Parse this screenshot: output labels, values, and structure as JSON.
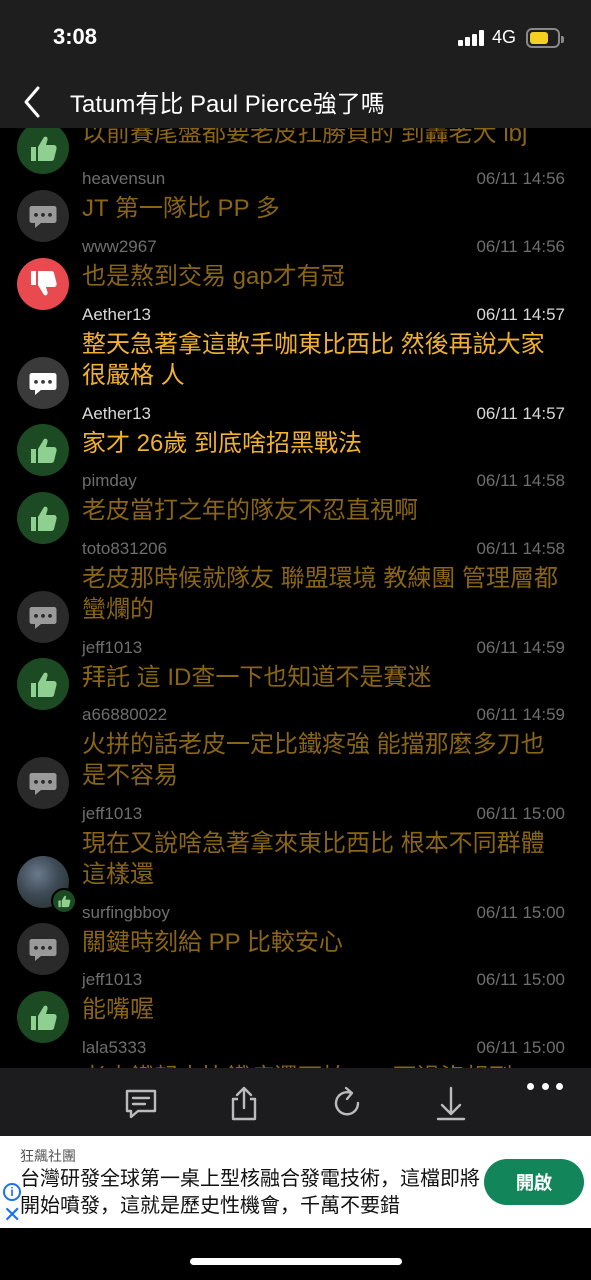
{
  "status_bar": {
    "time": "3:08",
    "network": "4G",
    "battery_level": 0.7
  },
  "header": {
    "title": "Tatum有比 Paul Pierce強了嗎"
  },
  "comments": [
    {
      "user": "",
      "date": "",
      "text": "以前賽尾盤都要老皮扛勝負的 到轟老大 lbj",
      "avatar": "msg"
    },
    {
      "user": "heavensun",
      "date": "06/11 14:56",
      "text": "JT 第一隊比 PP  多",
      "avatar": "up"
    },
    {
      "user": "www2967",
      "date": "06/11 14:56",
      "text": "也是熬到交易 gap才有冠",
      "avatar": "msg"
    },
    {
      "user": "Aether13",
      "date": "06/11 14:57",
      "text": "整天急著拿這軟手咖東比西比 然後再說大家很嚴格 人",
      "avatar": "down",
      "highlight": true
    },
    {
      "user": "Aether13",
      "date": "06/11 14:57",
      "text": "家才 26歲 到底啥招黑戰法",
      "avatar": "msg",
      "highlight": true
    },
    {
      "user": "pimday",
      "date": "06/11 14:58",
      "text": "老皮當打之年的隊友不忍直視啊",
      "avatar": "up"
    },
    {
      "user": "toto831206",
      "date": "06/11 14:58",
      "text": "老皮那時候就隊友 聯盟環境 教練團 管理層都蠻爛的",
      "avatar": "up"
    },
    {
      "user": "jeff1013",
      "date": "06/11 14:59",
      "text": "拜託 這 ID查一下也知道不是賽迷",
      "avatar": "msg"
    },
    {
      "user": "a66880022",
      "date": "06/11 14:59",
      "text": "火拼的話老皮一定比鐵疼強 能擋那麼多刀也是不容易",
      "avatar": "up"
    },
    {
      "user": "jeff1013",
      "date": "06/11 15:00",
      "text": "現在又說啥急著拿來東比西比 根本不同群體 這樣還",
      "avatar": "msg"
    },
    {
      "user": "surfingbboy",
      "date": "06/11 15:00",
      "text": "關鍵時刻給 PP 比較安心",
      "avatar": "photo"
    },
    {
      "user": "jeff1013",
      "date": "06/11 15:00",
      "text": "能嘴喔",
      "avatar": "msg"
    },
    {
      "user": "lala5333",
      "date": "06/11 15:00",
      "text": "老皮鐵起來比鐵疼還可怕 XD 不過沒想到",
      "avatar": "up"
    }
  ],
  "toolbar": {
    "icons": [
      "comment-icon",
      "share-icon",
      "refresh-icon",
      "download-icon",
      "more-icon"
    ]
  },
  "ad": {
    "sponsor": "狂飆社團",
    "headline": "台灣研發全球第一桌上型核融合發電技術，這檔即將開始噴發，這就是歷史性機會，千萬不要錯",
    "cta": "開啟"
  }
}
